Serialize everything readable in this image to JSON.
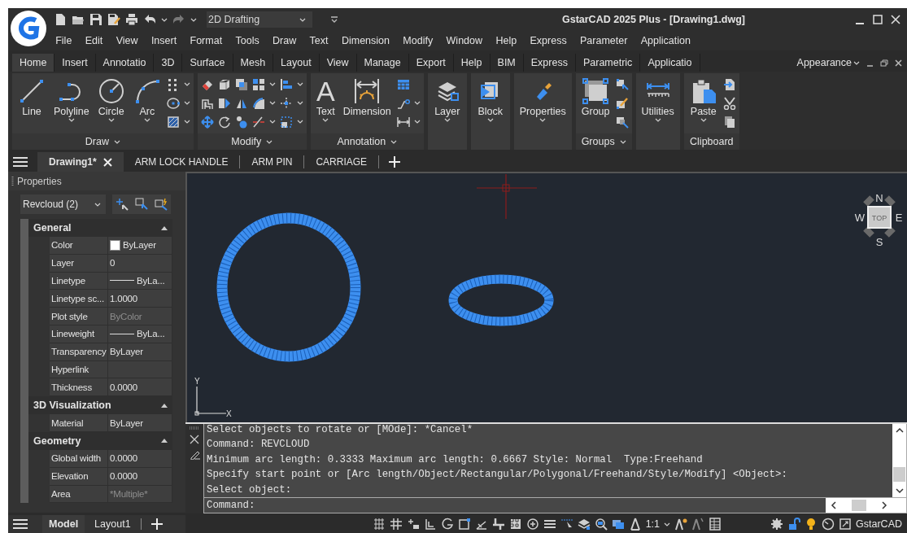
{
  "app": {
    "title": "GstarCAD 2025 Plus - [Drawing1.dwg]",
    "workspace": "2D Drafting"
  },
  "menu": [
    "File",
    "Edit",
    "View",
    "Insert",
    "Format",
    "Tools",
    "Draw",
    "Text",
    "Dimension",
    "Modify",
    "Window",
    "Help",
    "Express",
    "Parameter",
    "Application"
  ],
  "ribbon": {
    "tabs": [
      {
        "label": "Home",
        "selected": true
      },
      {
        "label": "Insert",
        "selected": false
      },
      {
        "label": "Annotatio",
        "selected": false
      },
      {
        "label": "3D",
        "selected": false
      },
      {
        "label": "Surface",
        "selected": false
      },
      {
        "label": "Mesh",
        "selected": false
      },
      {
        "label": "Layout",
        "selected": false
      },
      {
        "label": "View",
        "selected": false
      },
      {
        "label": "Manage",
        "selected": false
      },
      {
        "label": "Export",
        "selected": false
      },
      {
        "label": "Help",
        "selected": false
      },
      {
        "label": "BIM",
        "selected": false
      },
      {
        "label": "Express",
        "selected": false
      },
      {
        "label": "Parametric",
        "selected": false
      },
      {
        "label": "Applicatio",
        "selected": false
      }
    ],
    "appearance": "Appearance",
    "panels": [
      {
        "kind": "draw",
        "title": "Draw",
        "title_menu": true,
        "buttons": [
          {
            "kind": "line",
            "label": "Line",
            "dropdown": false
          },
          {
            "kind": "polyline",
            "label": "Polyline",
            "dropdown": true
          },
          {
            "kind": "circle",
            "label": "Circle",
            "dropdown": true
          },
          {
            "kind": "arc",
            "label": "Arc",
            "dropdown": true
          }
        ]
      },
      {
        "kind": "modify",
        "title": "Modify",
        "title_menu": true
      },
      {
        "kind": "annotation",
        "title": "Annotation",
        "title_menu": true,
        "buttons": [
          {
            "kind": "text",
            "label": "Text",
            "glyph": "A",
            "dropdown": true
          },
          {
            "kind": "dimension",
            "label": "Dimension",
            "dropdown": false
          }
        ]
      },
      {
        "kind": "plain",
        "buttons": [
          {
            "kind": "layer",
            "label": "Layer",
            "dropdown": true
          }
        ]
      },
      {
        "kind": "plain",
        "buttons": [
          {
            "kind": "block",
            "label": "Block",
            "dropdown": true
          }
        ]
      },
      {
        "kind": "plain",
        "buttons": [
          {
            "kind": "properties",
            "label": "Properties",
            "dropdown": true
          }
        ]
      },
      {
        "kind": "groups",
        "title": "Groups",
        "title_menu": true,
        "buttons": [
          {
            "kind": "group",
            "label": "Group",
            "dropdown": false
          }
        ]
      },
      {
        "kind": "plain",
        "buttons": [
          {
            "kind": "utilities",
            "label": "Utilities",
            "dropdown": true
          }
        ]
      },
      {
        "kind": "clipboard",
        "title": "Clipboard",
        "title_menu": false,
        "buttons": [
          {
            "kind": "paste",
            "label": "Paste",
            "dropdown": true
          }
        ]
      }
    ]
  },
  "documents": [
    {
      "label": "Drawing1*",
      "selected": true
    },
    {
      "label": "ARM LOCK HANDLE",
      "selected": false
    },
    {
      "label": "ARM PIN",
      "selected": false
    },
    {
      "label": "CARRIAGE",
      "selected": false
    }
  ],
  "properties": {
    "title": "Properties",
    "selection": "Revcloud (2)",
    "sections": [
      {
        "title": "General",
        "expanded": true,
        "rows": [
          {
            "name": "Color",
            "value": "ByLayer",
            "kind": "color",
            "disabled": false
          },
          {
            "name": "Layer",
            "value": "0",
            "kind": "text",
            "disabled": false
          },
          {
            "name": "Linetype",
            "value": "ByLa...",
            "kind": "linetype",
            "disabled": false
          },
          {
            "name": "Linetype sc...",
            "value": "1.0000",
            "kind": "text",
            "disabled": false
          },
          {
            "name": "Plot style",
            "value": "ByColor",
            "kind": "text",
            "disabled": true
          },
          {
            "name": "Lineweight",
            "value": "ByLa...",
            "kind": "linetype",
            "disabled": false
          },
          {
            "name": "Transparency",
            "value": "ByLayer",
            "kind": "text",
            "disabled": false
          },
          {
            "name": "Hyperlink",
            "kind": "text",
            "disabled": false
          },
          {
            "name": "Thickness",
            "value": "0.0000",
            "kind": "text",
            "disabled": false
          }
        ]
      },
      {
        "title": "3D Visualization",
        "expanded": true,
        "rows": [
          {
            "name": "Material",
            "value": "ByLayer",
            "kind": "text",
            "disabled": false
          }
        ]
      },
      {
        "title": "Geometry",
        "expanded": true,
        "rows": [
          {
            "name": "Global width",
            "value": "0.0000",
            "kind": "text",
            "disabled": false
          },
          {
            "name": "Elevation",
            "value": "0.0000",
            "kind": "text",
            "disabled": false
          },
          {
            "name": "Area",
            "value": "*Multiple*",
            "kind": "text",
            "disabled": true
          }
        ]
      }
    ]
  },
  "viewport": {
    "viewcube": {
      "north": "N",
      "south": "S",
      "east": "E",
      "west": "W",
      "face": "TOP"
    },
    "ucs": {
      "x": "X",
      "y": "Y"
    }
  },
  "command": {
    "history": [
      "Select objects to rotate or [MOde]: *Cancel*",
      "Command: REVCLOUD",
      "Minimum arc length: 0.3333 Maximum arc length: 0.6667 Style: Normal  Type:Freehand",
      "Specify start point or [Arc length/Object/Rectangular/Polygonal/Freehand/Style/Modify] <Object>:",
      "Select object:"
    ],
    "prompt": "Command:"
  },
  "layouts": [
    {
      "label": "Model",
      "selected": true
    },
    {
      "label": "Layout1",
      "selected": false
    }
  ],
  "status": {
    "scale": "1:1",
    "product": "GstarCAD"
  }
}
